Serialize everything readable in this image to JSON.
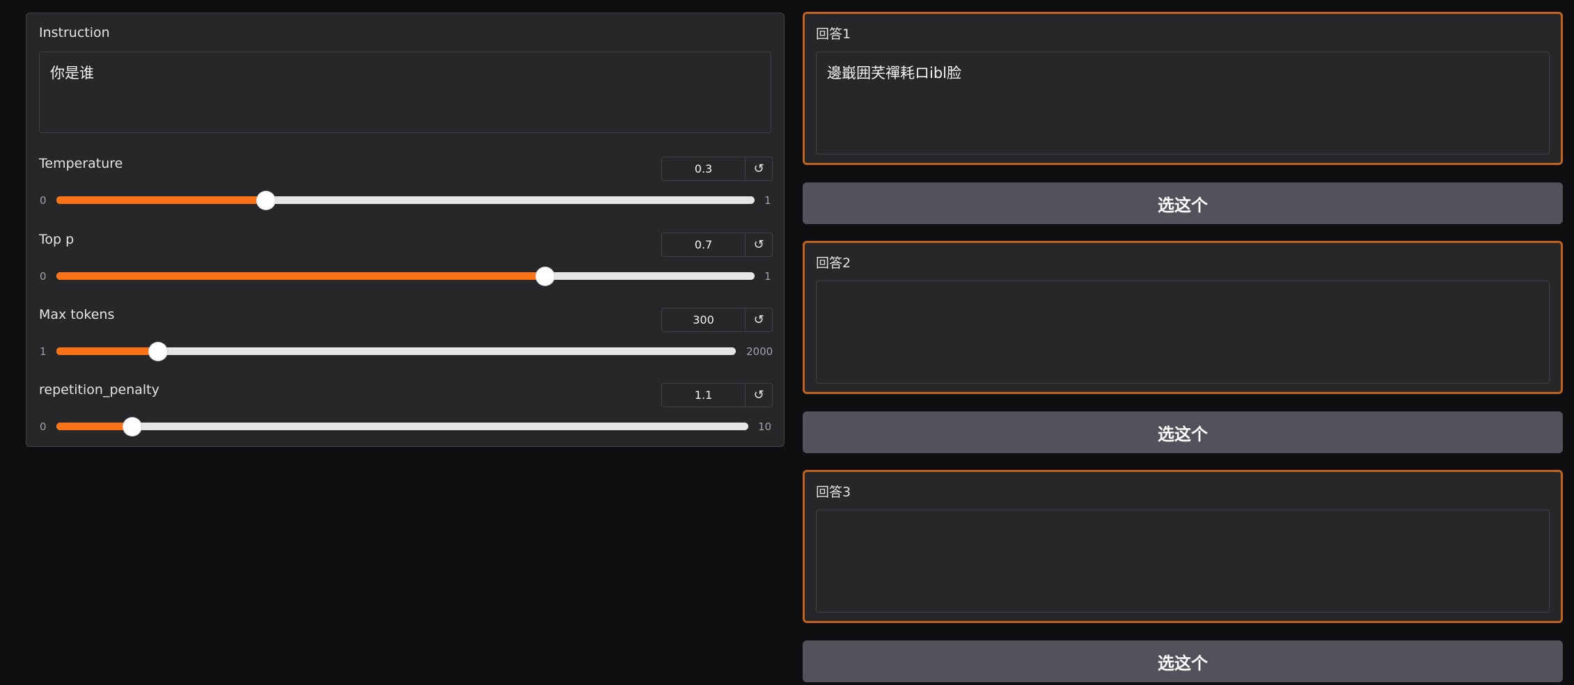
{
  "instruction": {
    "label": "Instruction",
    "value": "你是谁"
  },
  "sliders": [
    {
      "label": "Temperature",
      "value": "0.3",
      "min": "0",
      "max": "1",
      "fraction": 0.3
    },
    {
      "label": "Top p",
      "value": "0.7",
      "min": "0",
      "max": "1",
      "fraction": 0.7
    },
    {
      "label": "Max tokens",
      "value": "300",
      "min": "1",
      "max": "2000",
      "fraction": 0.15
    },
    {
      "label": "repetition_penalty",
      "value": "1.1",
      "min": "0",
      "max": "10",
      "fraction": 0.11
    }
  ],
  "reset_glyph": "↺",
  "answers": [
    {
      "label": "回答1",
      "value": "邊嶯囲芺禪耗ロibl脸",
      "button": "选这个"
    },
    {
      "label": "回答2",
      "value": "",
      "button": "选这个"
    },
    {
      "label": "回答3",
      "value": "",
      "button": "选这个"
    }
  ],
  "colors": {
    "accent": "#f97316",
    "answer_border": "#c2621f",
    "button_bg": "#52525b"
  }
}
